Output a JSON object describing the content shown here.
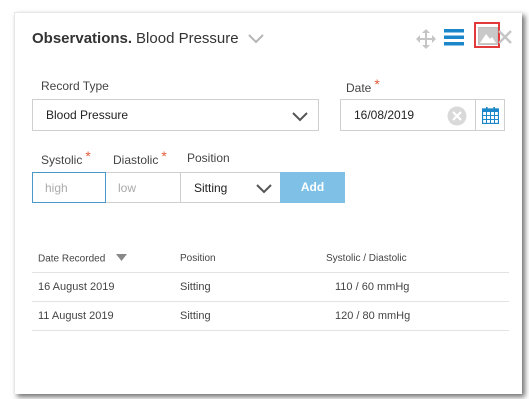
{
  "header": {
    "title_bold": "Observations.",
    "title_rest": "Blood Pressure"
  },
  "toolbar": {
    "icons": [
      "move-icon",
      "menu-icon",
      "image-icon",
      "close-icon"
    ],
    "highlight_color": "#e23a3a",
    "accent_color": "#1b87c9"
  },
  "form": {
    "record_type_label": "Record Type",
    "record_type_value": "Blood Pressure",
    "date_label": "Date",
    "date_value": "16/08/2019",
    "required_mark": "*",
    "systolic_label": "Systolic",
    "diastolic_label": "Diastolic",
    "position_label": "Position",
    "systolic_placeholder": "high",
    "diastolic_placeholder": "low",
    "position_value": "Sitting",
    "add_label": "Add",
    "add_color": "#7fc0e6"
  },
  "table": {
    "headers": [
      "Date Recorded",
      "Position",
      "Systolic / Diastolic"
    ],
    "rows": [
      [
        "16 August 2019",
        "Sitting",
        "110 / 60 mmHg"
      ],
      [
        "11 August 2019",
        "Sitting",
        "120 / 80 mmHg"
      ]
    ]
  }
}
